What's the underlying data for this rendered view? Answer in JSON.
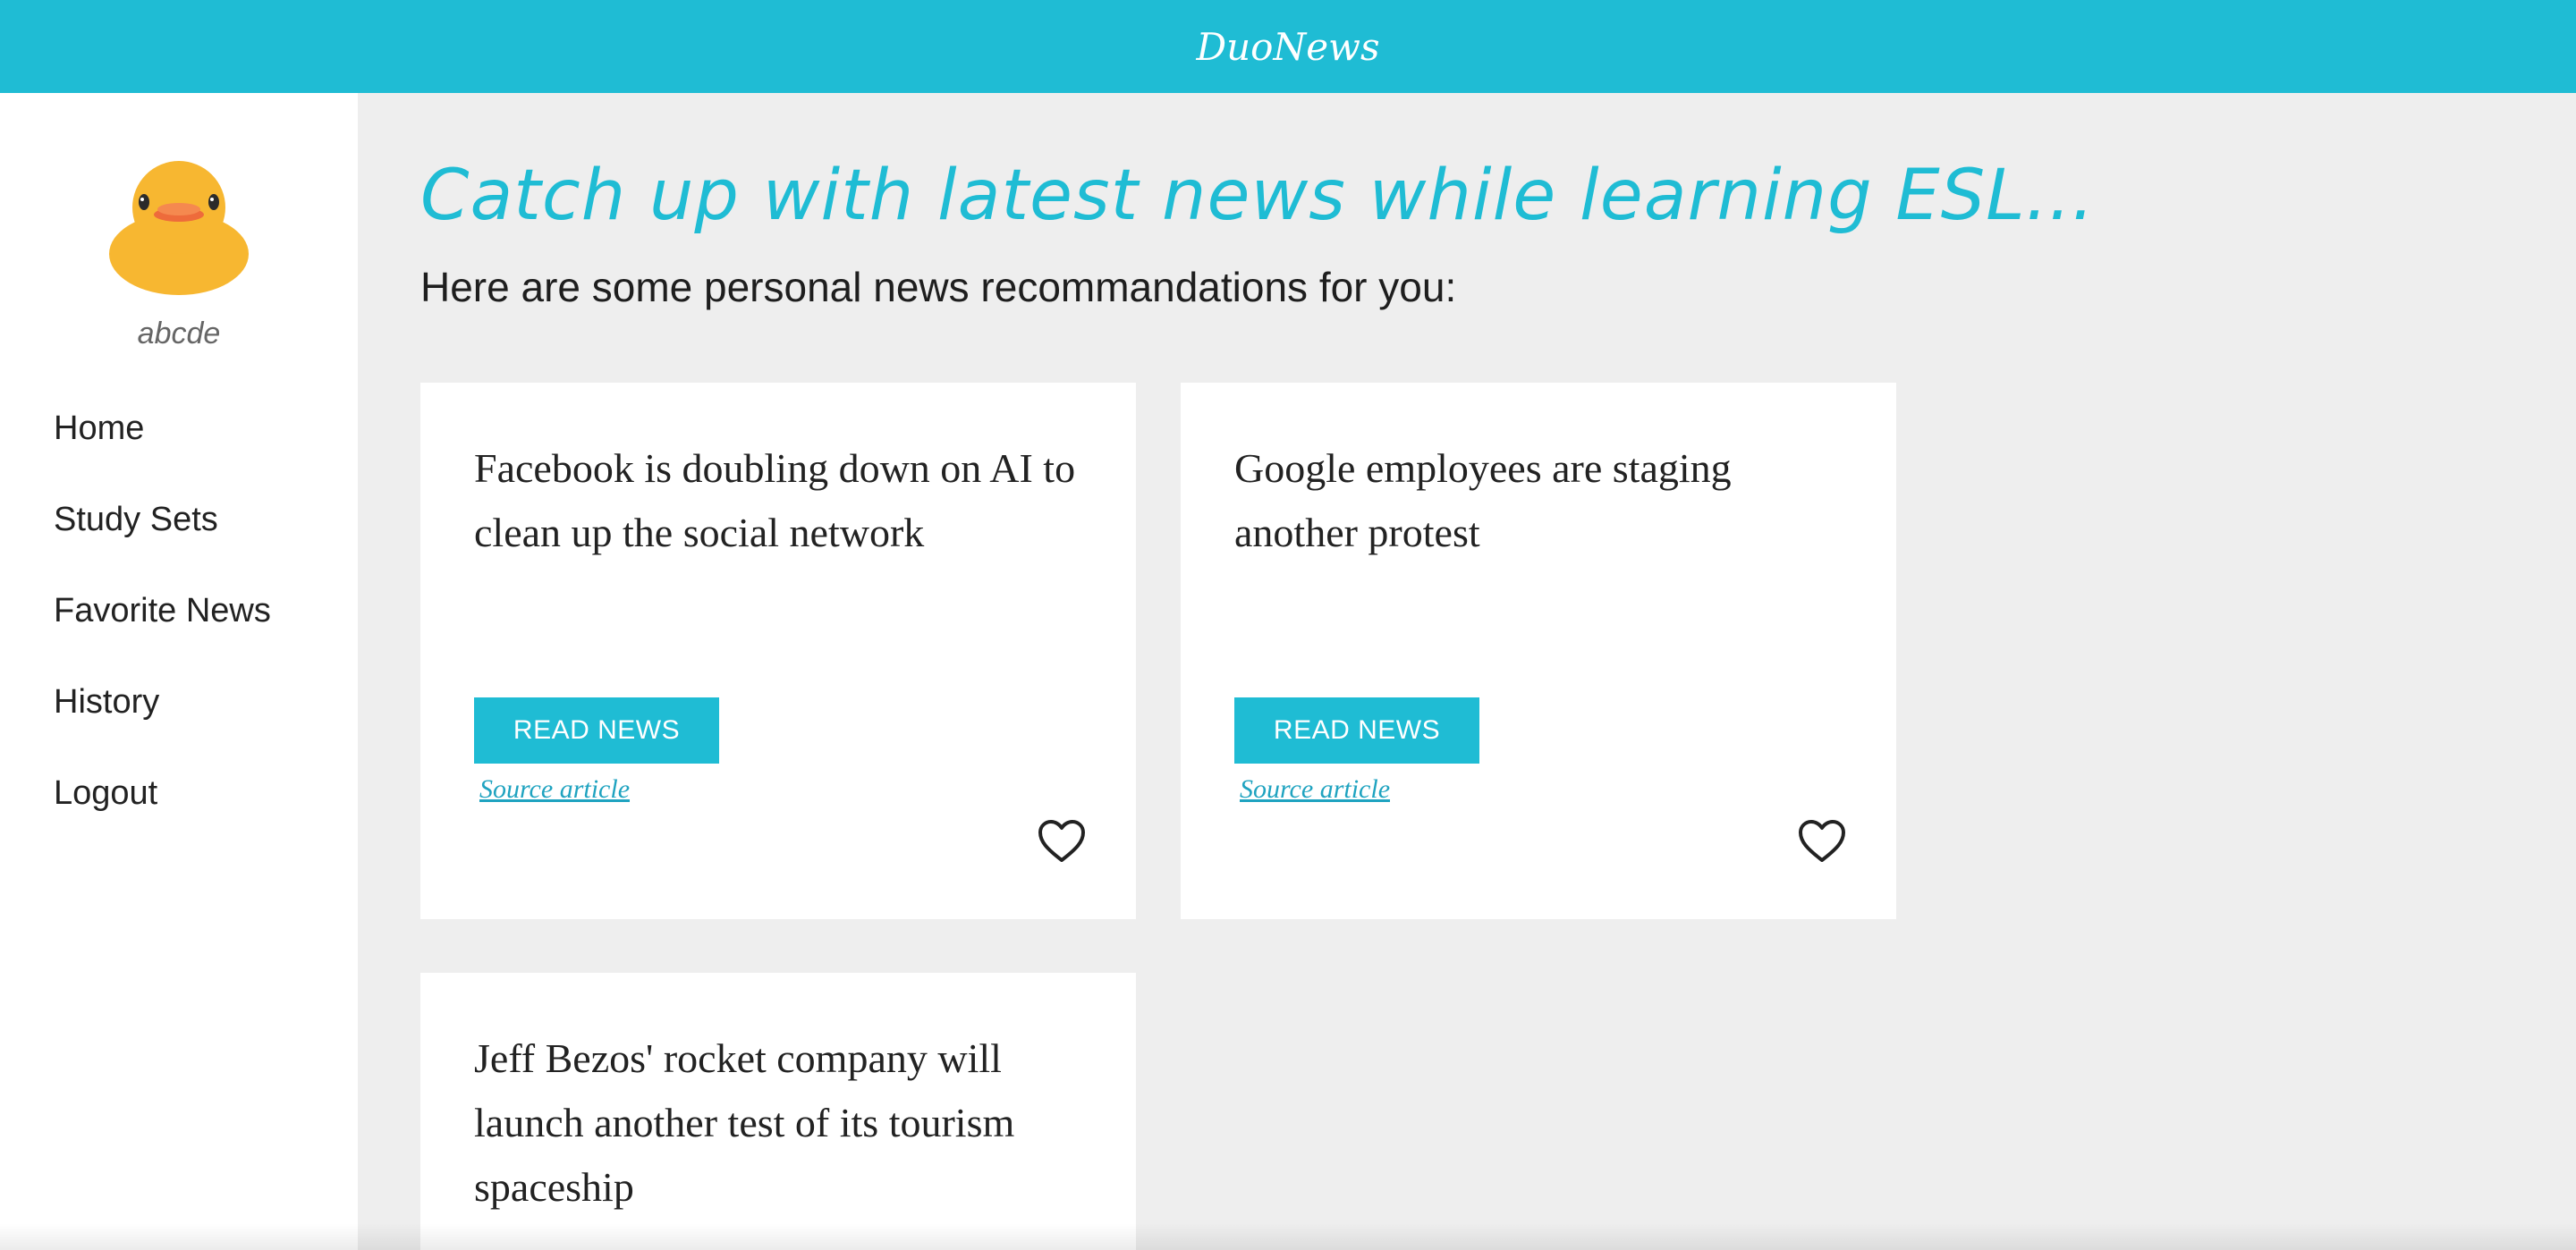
{
  "app": {
    "brand": "DuoNews"
  },
  "sidebar": {
    "avatar_icon": "rubber-duck-icon",
    "username": "abcde",
    "items": [
      {
        "label": "Home"
      },
      {
        "label": "Study Sets"
      },
      {
        "label": "Favorite News"
      },
      {
        "label": "History"
      },
      {
        "label": "Logout"
      }
    ]
  },
  "main": {
    "headline": "Catch up with latest news while learning ESL...",
    "subheading": "Here are some personal news recommandations for you:",
    "cards": [
      {
        "title": "Facebook is doubling down on AI to clean up the social network",
        "button_label": "READ NEWS",
        "link_label": "Source article",
        "favorite_icon": "heart-outline-icon"
      },
      {
        "title": "Google employees are staging another protest",
        "button_label": "READ NEWS",
        "link_label": "Source article",
        "favorite_icon": "heart-outline-icon"
      },
      {
        "title": "Jeff Bezos' rocket company will launch another test of its tourism spaceship"
      }
    ]
  },
  "colors": {
    "accent": "#1fbcd4",
    "background": "#eeeeee",
    "card": "#ffffff"
  }
}
